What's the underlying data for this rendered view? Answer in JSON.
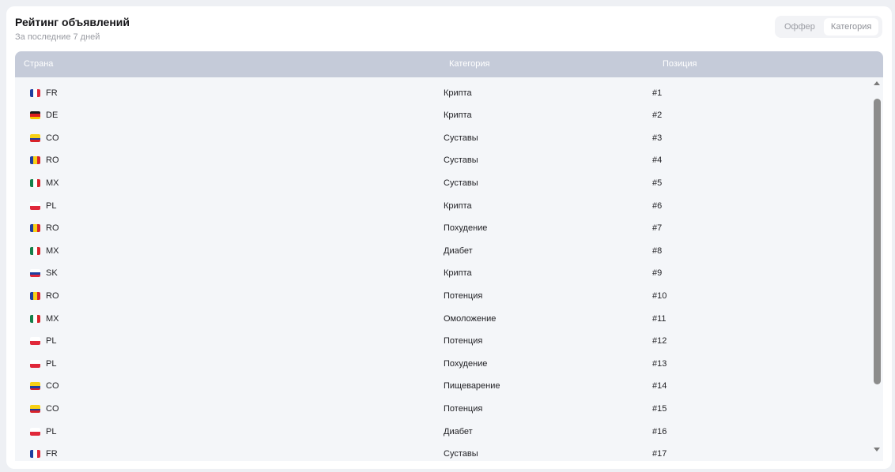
{
  "header": {
    "title": "Рейтинг объявлений",
    "subtitle": "За последние 7 дней"
  },
  "toggle": {
    "options": [
      "Оффер",
      "Категория"
    ],
    "active": "Категория"
  },
  "table": {
    "columns": [
      "Страна",
      "Категория",
      "Позиция"
    ],
    "rows": [
      {
        "country": "FR",
        "category": "Крипта",
        "position": "#1"
      },
      {
        "country": "DE",
        "category": "Крипта",
        "position": "#2"
      },
      {
        "country": "CO",
        "category": "Суставы",
        "position": "#3"
      },
      {
        "country": "RO",
        "category": "Суставы",
        "position": "#4"
      },
      {
        "country": "MX",
        "category": "Суставы",
        "position": "#5"
      },
      {
        "country": "PL",
        "category": "Крипта",
        "position": "#6"
      },
      {
        "country": "RO",
        "category": "Похудение",
        "position": "#7"
      },
      {
        "country": "MX",
        "category": "Диабет",
        "position": "#8"
      },
      {
        "country": "SK",
        "category": "Крипта",
        "position": "#9"
      },
      {
        "country": "RO",
        "category": "Потенция",
        "position": "#10"
      },
      {
        "country": "MX",
        "category": "Омоложение",
        "position": "#11"
      },
      {
        "country": "PL",
        "category": "Потенция",
        "position": "#12"
      },
      {
        "country": "PL",
        "category": "Похудение",
        "position": "#13"
      },
      {
        "country": "CO",
        "category": "Пищеварение",
        "position": "#14"
      },
      {
        "country": "CO",
        "category": "Потенция",
        "position": "#15"
      },
      {
        "country": "PL",
        "category": "Диабет",
        "position": "#16"
      },
      {
        "country": "FR",
        "category": "Суставы",
        "position": "#17"
      }
    ]
  },
  "flags": {
    "FR": {
      "dir": "v",
      "colors": [
        "#1f3fa0",
        "#ffffff",
        "#e0283a"
      ]
    },
    "DE": {
      "dir": "h",
      "colors": [
        "#1a1a1a",
        "#dd1f1f",
        "#f7c600"
      ]
    },
    "CO": {
      "dir": "h",
      "colors": [
        "#f7d116",
        "#f7d116",
        "#1f3fa0",
        "#d8232a"
      ]
    },
    "RO": {
      "dir": "v",
      "colors": [
        "#1f3fa0",
        "#f7d116",
        "#d8232a"
      ]
    },
    "MX": {
      "dir": "v",
      "colors": [
        "#14804a",
        "#ffffff",
        "#d8232a"
      ]
    },
    "PL": {
      "dir": "h",
      "colors": [
        "#ffffff",
        "#e0283a"
      ]
    },
    "SK": {
      "dir": "h",
      "colors": [
        "#ffffff",
        "#1f3fa0",
        "#e0283a"
      ]
    }
  },
  "colors": {
    "header_bg": "#c5cbd9",
    "body_bg": "#f4f6f9",
    "scrollbar": "#8c8c8c"
  }
}
